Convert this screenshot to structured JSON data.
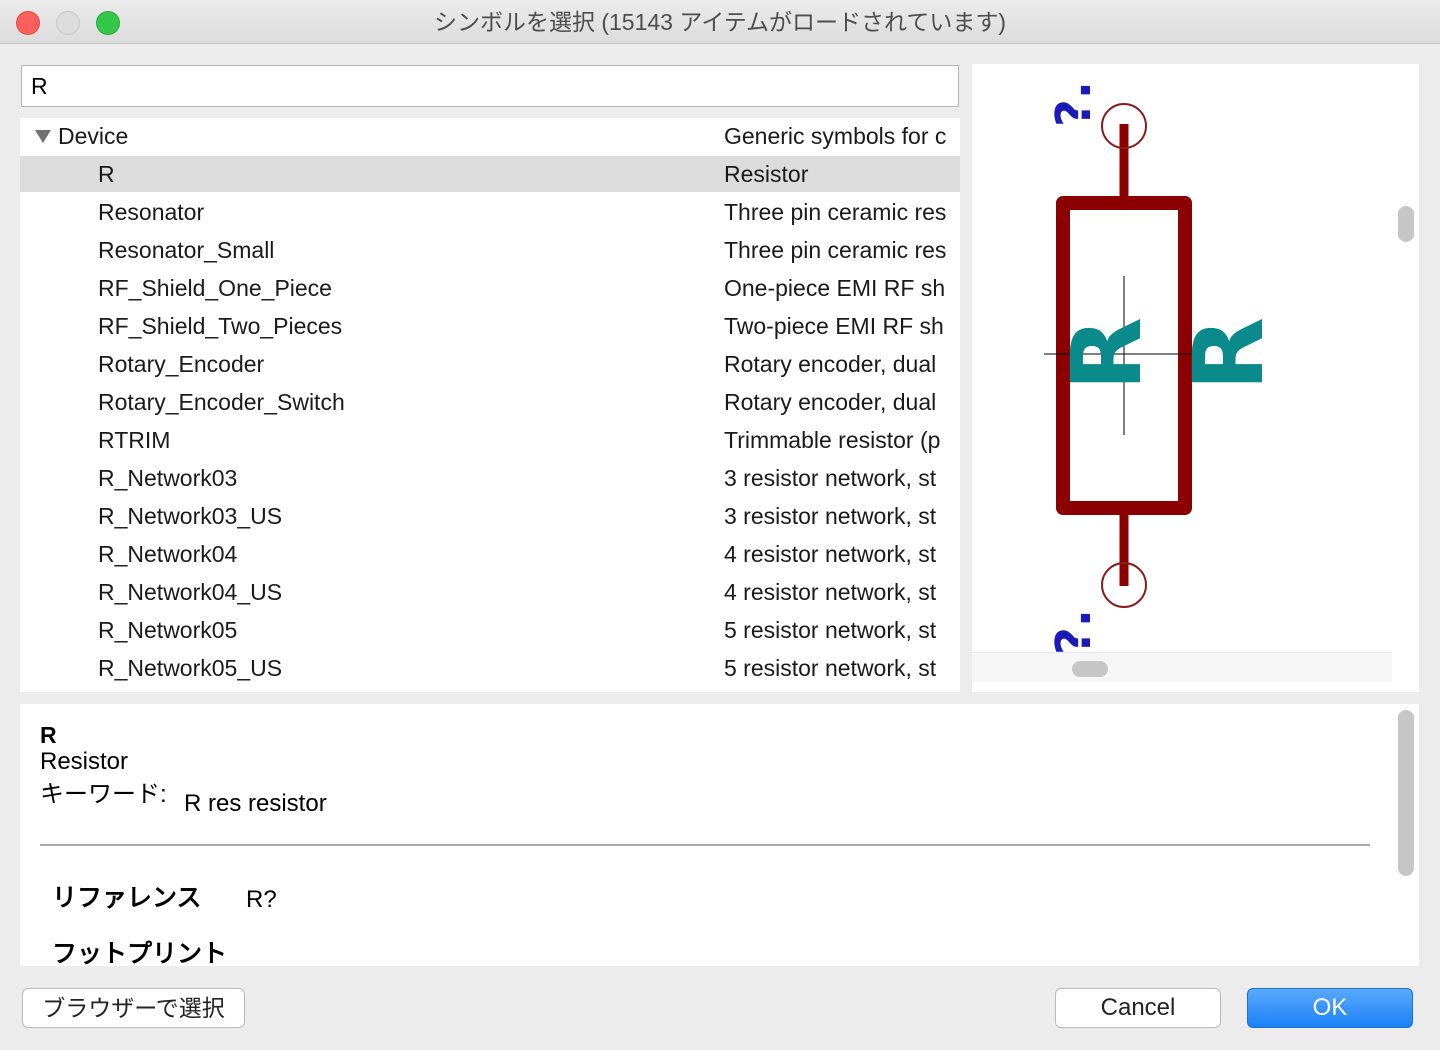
{
  "window": {
    "title": "シンボルを選択 (15143 アイテムがロードされています)"
  },
  "search": {
    "value": "R"
  },
  "tree": {
    "group": {
      "name": "Device",
      "description": "Generic symbols for c"
    },
    "items": [
      {
        "name": "R",
        "description": "Resistor",
        "selected": true
      },
      {
        "name": "Resonator",
        "description": "Three pin ceramic res"
      },
      {
        "name": "Resonator_Small",
        "description": "Three pin ceramic res"
      },
      {
        "name": "RF_Shield_One_Piece",
        "description": "One-piece EMI RF sh"
      },
      {
        "name": "RF_Shield_Two_Pieces",
        "description": "Two-piece EMI RF sh"
      },
      {
        "name": "Rotary_Encoder",
        "description": "Rotary encoder, dual"
      },
      {
        "name": "Rotary_Encoder_Switch",
        "description": "Rotary encoder, dual"
      },
      {
        "name": "RTRIM",
        "description": "Trimmable resistor (p"
      },
      {
        "name": "R_Network03",
        "description": "3 resistor network, st"
      },
      {
        "name": "R_Network03_US",
        "description": "3 resistor network, st"
      },
      {
        "name": "R_Network04",
        "description": "4 resistor network, st"
      },
      {
        "name": "R_Network04_US",
        "description": "4 resistor network, st"
      },
      {
        "name": "R_Network05",
        "description": "5 resistor network, st"
      },
      {
        "name": "R_Network05_US",
        "description": "5 resistor network, st"
      }
    ]
  },
  "preview": {
    "ref_top": "?.",
    "ref_bottom": "?.",
    "value_label": "R",
    "value_label_2": "R",
    "colors": {
      "body": "#8b0000",
      "pin_circle": "#8b1a1a",
      "reference": "#1a1ab8",
      "value": "#0a8a8a"
    }
  },
  "info": {
    "name": "R",
    "description": "Resistor",
    "keywords_label": "キーワード:",
    "keywords": "R res resistor",
    "fields": [
      {
        "label": "リファレンス",
        "value": "R?"
      },
      {
        "label": "フットプリント",
        "value": ""
      }
    ]
  },
  "buttons": {
    "browse": "ブラウザーで選択",
    "cancel": "Cancel",
    "ok": "OK"
  }
}
